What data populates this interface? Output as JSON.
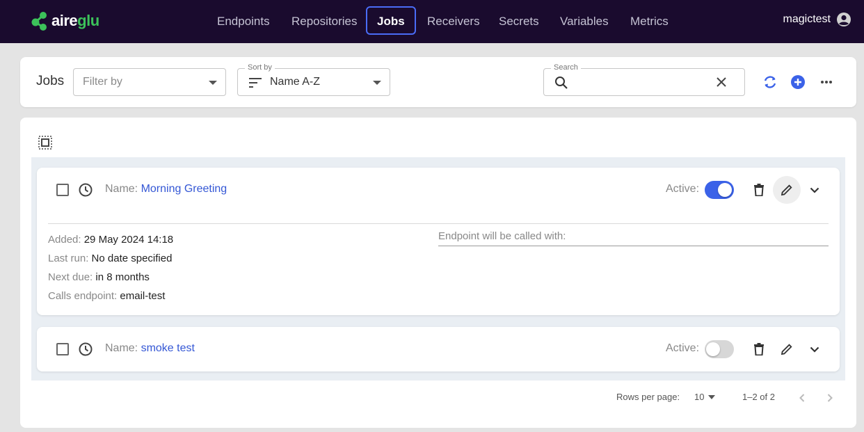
{
  "brand": {
    "part1": "aire",
    "part2": "glu"
  },
  "nav": [
    {
      "label": "Endpoints",
      "active": false
    },
    {
      "label": "Repositories",
      "active": false
    },
    {
      "label": "Jobs",
      "active": true
    },
    {
      "label": "Receivers",
      "active": false
    },
    {
      "label": "Secrets",
      "active": false
    },
    {
      "label": "Variables",
      "active": false
    },
    {
      "label": "Metrics",
      "active": false
    }
  ],
  "user": {
    "name": "magictest",
    "icon": "account-circle-icon"
  },
  "toolbar": {
    "title": "Jobs",
    "filter": {
      "placeholder": "Filter by",
      "value": ""
    },
    "sort": {
      "label": "Sort by",
      "value": "Name A-Z"
    },
    "search": {
      "label": "Search",
      "value": ""
    }
  },
  "jobs": [
    {
      "name_key": "Name:",
      "name": "Morning Greeting",
      "active_label": "Active:",
      "active": true,
      "expanded": true,
      "details": {
        "added_key": "Added:",
        "added": "29 May 2024 14:18",
        "last_run_key": "Last run:",
        "last_run": "No date specified",
        "next_due_key": "Next due:",
        "next_due": "in 8 months",
        "calls_key": "Calls endpoint:",
        "calls": "email-test",
        "endpoint_label": "Endpoint will be called with:"
      }
    },
    {
      "name_key": "Name:",
      "name": "smoke test",
      "active_label": "Active:",
      "active": false,
      "expanded": false
    }
  ],
  "pagination": {
    "rows_label": "Rows per page:",
    "rows_value": "10",
    "range": "1–2 of 2"
  },
  "colors": {
    "accent": "#3b62e8",
    "topbar": "#1a0b2e",
    "brand_green": "#3cc25a"
  }
}
